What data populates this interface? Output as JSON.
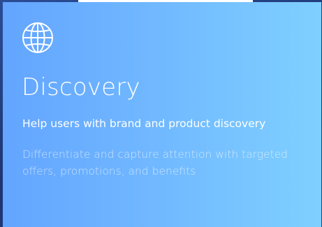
{
  "card": {
    "icon": "globe-icon",
    "title": "Discovery",
    "subtitle": "Help users with brand and product discovery",
    "description": "Differentiate and capture attention with targeted offers, promotions, and benefits"
  },
  "colors": {
    "card_gradient_start": "#63a5ff",
    "card_gradient_end": "#7fd0ff",
    "text_primary": "#ffffff"
  }
}
